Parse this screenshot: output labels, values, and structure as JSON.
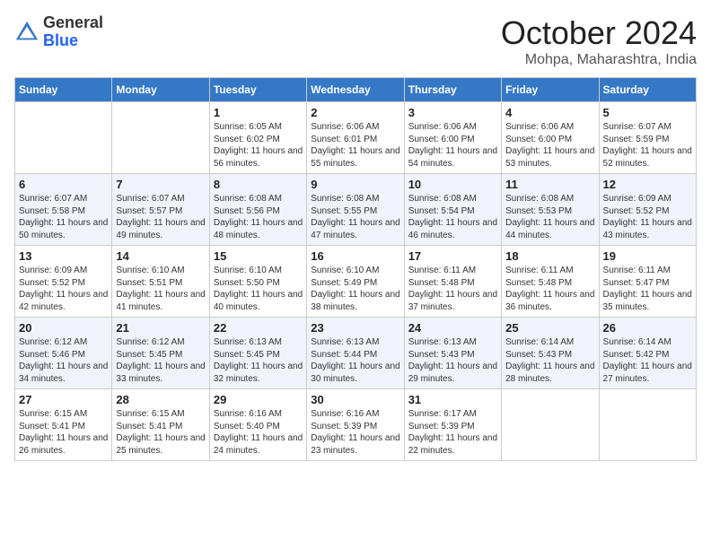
{
  "header": {
    "logo": {
      "general": "General",
      "blue": "Blue"
    },
    "title": "October 2024",
    "subtitle": "Mohpa, Maharashtra, India"
  },
  "calendar": {
    "days_of_week": [
      "Sunday",
      "Monday",
      "Tuesday",
      "Wednesday",
      "Thursday",
      "Friday",
      "Saturday"
    ],
    "weeks": [
      [
        {
          "day": "",
          "sunrise": "",
          "sunset": "",
          "daylight": ""
        },
        {
          "day": "",
          "sunrise": "",
          "sunset": "",
          "daylight": ""
        },
        {
          "day": "1",
          "sunrise": "Sunrise: 6:05 AM",
          "sunset": "Sunset: 6:02 PM",
          "daylight": "Daylight: 11 hours and 56 minutes."
        },
        {
          "day": "2",
          "sunrise": "Sunrise: 6:06 AM",
          "sunset": "Sunset: 6:01 PM",
          "daylight": "Daylight: 11 hours and 55 minutes."
        },
        {
          "day": "3",
          "sunrise": "Sunrise: 6:06 AM",
          "sunset": "Sunset: 6:00 PM",
          "daylight": "Daylight: 11 hours and 54 minutes."
        },
        {
          "day": "4",
          "sunrise": "Sunrise: 6:06 AM",
          "sunset": "Sunset: 6:00 PM",
          "daylight": "Daylight: 11 hours and 53 minutes."
        },
        {
          "day": "5",
          "sunrise": "Sunrise: 6:07 AM",
          "sunset": "Sunset: 5:59 PM",
          "daylight": "Daylight: 11 hours and 52 minutes."
        }
      ],
      [
        {
          "day": "6",
          "sunrise": "Sunrise: 6:07 AM",
          "sunset": "Sunset: 5:58 PM",
          "daylight": "Daylight: 11 hours and 50 minutes."
        },
        {
          "day": "7",
          "sunrise": "Sunrise: 6:07 AM",
          "sunset": "Sunset: 5:57 PM",
          "daylight": "Daylight: 11 hours and 49 minutes."
        },
        {
          "day": "8",
          "sunrise": "Sunrise: 6:08 AM",
          "sunset": "Sunset: 5:56 PM",
          "daylight": "Daylight: 11 hours and 48 minutes."
        },
        {
          "day": "9",
          "sunrise": "Sunrise: 6:08 AM",
          "sunset": "Sunset: 5:55 PM",
          "daylight": "Daylight: 11 hours and 47 minutes."
        },
        {
          "day": "10",
          "sunrise": "Sunrise: 6:08 AM",
          "sunset": "Sunset: 5:54 PM",
          "daylight": "Daylight: 11 hours and 46 minutes."
        },
        {
          "day": "11",
          "sunrise": "Sunrise: 6:08 AM",
          "sunset": "Sunset: 5:53 PM",
          "daylight": "Daylight: 11 hours and 44 minutes."
        },
        {
          "day": "12",
          "sunrise": "Sunrise: 6:09 AM",
          "sunset": "Sunset: 5:52 PM",
          "daylight": "Daylight: 11 hours and 43 minutes."
        }
      ],
      [
        {
          "day": "13",
          "sunrise": "Sunrise: 6:09 AM",
          "sunset": "Sunset: 5:52 PM",
          "daylight": "Daylight: 11 hours and 42 minutes."
        },
        {
          "day": "14",
          "sunrise": "Sunrise: 6:10 AM",
          "sunset": "Sunset: 5:51 PM",
          "daylight": "Daylight: 11 hours and 41 minutes."
        },
        {
          "day": "15",
          "sunrise": "Sunrise: 6:10 AM",
          "sunset": "Sunset: 5:50 PM",
          "daylight": "Daylight: 11 hours and 40 minutes."
        },
        {
          "day": "16",
          "sunrise": "Sunrise: 6:10 AM",
          "sunset": "Sunset: 5:49 PM",
          "daylight": "Daylight: 11 hours and 38 minutes."
        },
        {
          "day": "17",
          "sunrise": "Sunrise: 6:11 AM",
          "sunset": "Sunset: 5:48 PM",
          "daylight": "Daylight: 11 hours and 37 minutes."
        },
        {
          "day": "18",
          "sunrise": "Sunrise: 6:11 AM",
          "sunset": "Sunset: 5:48 PM",
          "daylight": "Daylight: 11 hours and 36 minutes."
        },
        {
          "day": "19",
          "sunrise": "Sunrise: 6:11 AM",
          "sunset": "Sunset: 5:47 PM",
          "daylight": "Daylight: 11 hours and 35 minutes."
        }
      ],
      [
        {
          "day": "20",
          "sunrise": "Sunrise: 6:12 AM",
          "sunset": "Sunset: 5:46 PM",
          "daylight": "Daylight: 11 hours and 34 minutes."
        },
        {
          "day": "21",
          "sunrise": "Sunrise: 6:12 AM",
          "sunset": "Sunset: 5:45 PM",
          "daylight": "Daylight: 11 hours and 33 minutes."
        },
        {
          "day": "22",
          "sunrise": "Sunrise: 6:13 AM",
          "sunset": "Sunset: 5:45 PM",
          "daylight": "Daylight: 11 hours and 32 minutes."
        },
        {
          "day": "23",
          "sunrise": "Sunrise: 6:13 AM",
          "sunset": "Sunset: 5:44 PM",
          "daylight": "Daylight: 11 hours and 30 minutes."
        },
        {
          "day": "24",
          "sunrise": "Sunrise: 6:13 AM",
          "sunset": "Sunset: 5:43 PM",
          "daylight": "Daylight: 11 hours and 29 minutes."
        },
        {
          "day": "25",
          "sunrise": "Sunrise: 6:14 AM",
          "sunset": "Sunset: 5:43 PM",
          "daylight": "Daylight: 11 hours and 28 minutes."
        },
        {
          "day": "26",
          "sunrise": "Sunrise: 6:14 AM",
          "sunset": "Sunset: 5:42 PM",
          "daylight": "Daylight: 11 hours and 27 minutes."
        }
      ],
      [
        {
          "day": "27",
          "sunrise": "Sunrise: 6:15 AM",
          "sunset": "Sunset: 5:41 PM",
          "daylight": "Daylight: 11 hours and 26 minutes."
        },
        {
          "day": "28",
          "sunrise": "Sunrise: 6:15 AM",
          "sunset": "Sunset: 5:41 PM",
          "daylight": "Daylight: 11 hours and 25 minutes."
        },
        {
          "day": "29",
          "sunrise": "Sunrise: 6:16 AM",
          "sunset": "Sunset: 5:40 PM",
          "daylight": "Daylight: 11 hours and 24 minutes."
        },
        {
          "day": "30",
          "sunrise": "Sunrise: 6:16 AM",
          "sunset": "Sunset: 5:39 PM",
          "daylight": "Daylight: 11 hours and 23 minutes."
        },
        {
          "day": "31",
          "sunrise": "Sunrise: 6:17 AM",
          "sunset": "Sunset: 5:39 PM",
          "daylight": "Daylight: 11 hours and 22 minutes."
        },
        {
          "day": "",
          "sunrise": "",
          "sunset": "",
          "daylight": ""
        },
        {
          "day": "",
          "sunrise": "",
          "sunset": "",
          "daylight": ""
        }
      ]
    ]
  }
}
